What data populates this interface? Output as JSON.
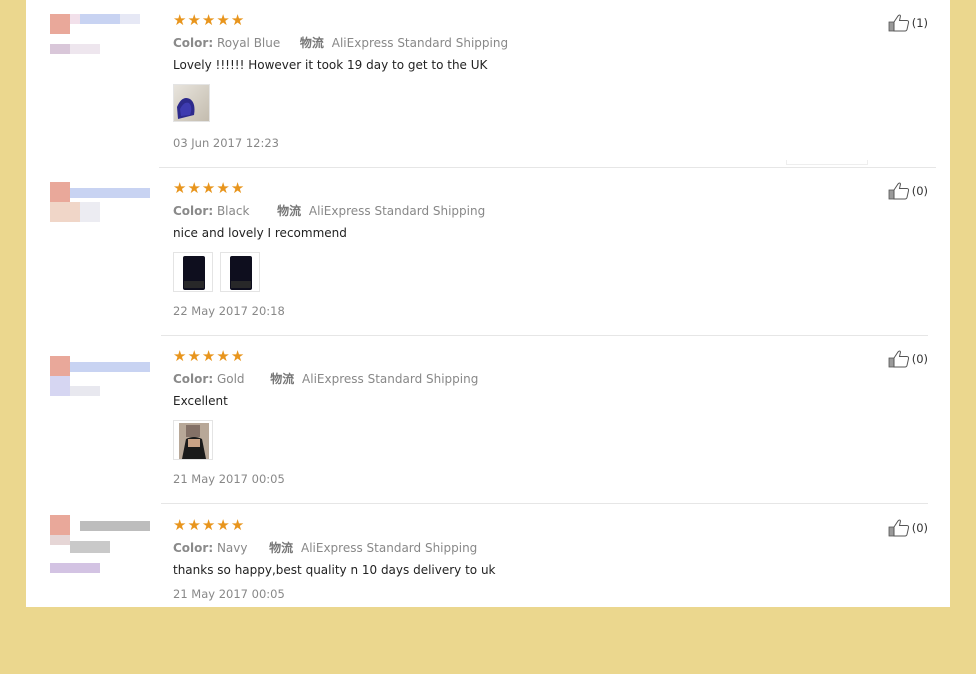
{
  "reviews": [
    {
      "color_label": "Color:",
      "color_value": "Royal Blue",
      "shipping_label": "物流",
      "shipping_value": "AliExpress Standard Shipping",
      "text": "Lovely !!!!!! However it took 19 day to get to the UK",
      "date": "03 Jun 2017 12:23",
      "helpful_count": "(1)",
      "rating": 5,
      "thumbnails": [
        "purple-item-photo"
      ]
    },
    {
      "color_label": "Color:",
      "color_value": "Black",
      "shipping_label": "物流",
      "shipping_value": "AliExpress Standard Shipping",
      "text": "nice and lovely I recommend",
      "date": "22 May 2017 20:18",
      "helpful_count": "(0)",
      "rating": 5,
      "thumbnails": [
        "dark-item-photo",
        "dark-item-photo"
      ]
    },
    {
      "color_label": "Color:",
      "color_value": "Gold",
      "shipping_label": "物流",
      "shipping_value": "AliExpress Standard Shipping",
      "text": "Excellent",
      "date": "21 May 2017 00:05",
      "helpful_count": "(0)",
      "rating": 5,
      "thumbnails": [
        "person-photo"
      ]
    },
    {
      "color_label": "Color:",
      "color_value": "Navy",
      "shipping_label": "物流",
      "shipping_value": "AliExpress Standard Shipping",
      "text": "thanks so happy,best quality n 10 days delivery to uk",
      "date": "21 May 2017 00:05",
      "helpful_count": "(0)",
      "rating": 5,
      "thumbnails": []
    }
  ],
  "icons": {
    "star": "star-icon",
    "helpful": "thumbs-up-icon"
  },
  "colors": {
    "star": "#e8951d",
    "background": "#ebd78e",
    "panel": "#ffffff"
  }
}
